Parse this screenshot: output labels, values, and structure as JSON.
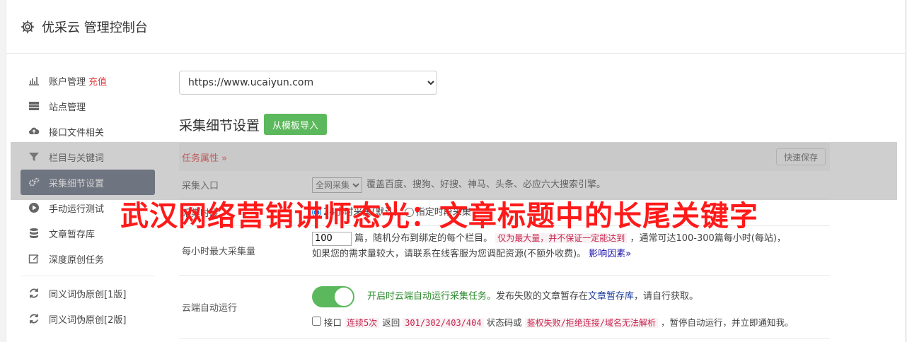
{
  "header": {
    "title": "优采云 管理控制台",
    "icon": "gear-icon"
  },
  "sidebar": {
    "items": [
      {
        "label": "账户管理",
        "extra": "充值",
        "icon": "bar-chart-icon"
      },
      {
        "label": "站点管理",
        "icon": "server-icon"
      },
      {
        "label": "接口文件相关",
        "icon": "cloud-upload-icon"
      },
      {
        "label": "栏目与关键词",
        "icon": "filter-icon"
      },
      {
        "label": "采集细节设置",
        "icon": "gears-icon",
        "active": true
      },
      {
        "label": "手动运行测试",
        "icon": "play-circle-icon"
      },
      {
        "label": "文章暂存库",
        "icon": "database-icon"
      },
      {
        "label": "深度原创任务",
        "icon": "edit-icon"
      },
      {
        "label": "同义词伪原创[1版]",
        "icon": "refresh-icon"
      },
      {
        "label": "同义词伪原创[2版]",
        "icon": "refresh-icon"
      }
    ]
  },
  "main": {
    "site_select": {
      "value": "https://www.ucaiyun.com"
    },
    "section_title": "采集细节设置",
    "import_button": "从模板导入",
    "task_props": "任务属性 »",
    "quick_save": "快速保存",
    "rows": {
      "entry": {
        "label": "采集入口",
        "select_value": "全网采集",
        "desc": "覆盖百度、搜狗、好搜、神马、头条、必应六大搜索引擎。"
      },
      "timing": {
        "label": "采集时段",
        "option1": "24小时采集(默认)",
        "option2": "指定时段采集"
      },
      "max_per_hour": {
        "label": "每小时最大采集量",
        "value": "100",
        "text1": "篇，随机分布到绑定的每个栏目。",
        "code1": "仅为最大量，并不保证一定能达到",
        "text2": "，通常可达100-300篇每小时(每站)，",
        "text3": "如果您的需求量较大，请联系在线客服为您调配资源(不额外收费)。",
        "link": "影响因素»"
      },
      "cloud_run": {
        "label": "云端自动运行",
        "toggle_on": true,
        "green_text": "开启时云端自动运行采集任务。",
        "text1": "发布失败的文章暂存在",
        "link": "文章暂存库",
        "text2": "，请自行获取。",
        "check_label": "接口",
        "code1": "连续5次",
        "text3": "返回",
        "code2": "301/302/403/404",
        "text4": "状态码或",
        "code3": "鉴权失败/拒绝连接/域名无法解析",
        "text5": "，暂停自动运行，并立即通知我。"
      }
    }
  },
  "overlay": {
    "watermark": "武汉网络营销讲师态光：文章标题中的长尾关键字"
  },
  "colors": {
    "accent_green": "#5cb85c",
    "active_nav": "#586277",
    "red": "#e4393c",
    "watermark_red": "#ff1a1a"
  }
}
